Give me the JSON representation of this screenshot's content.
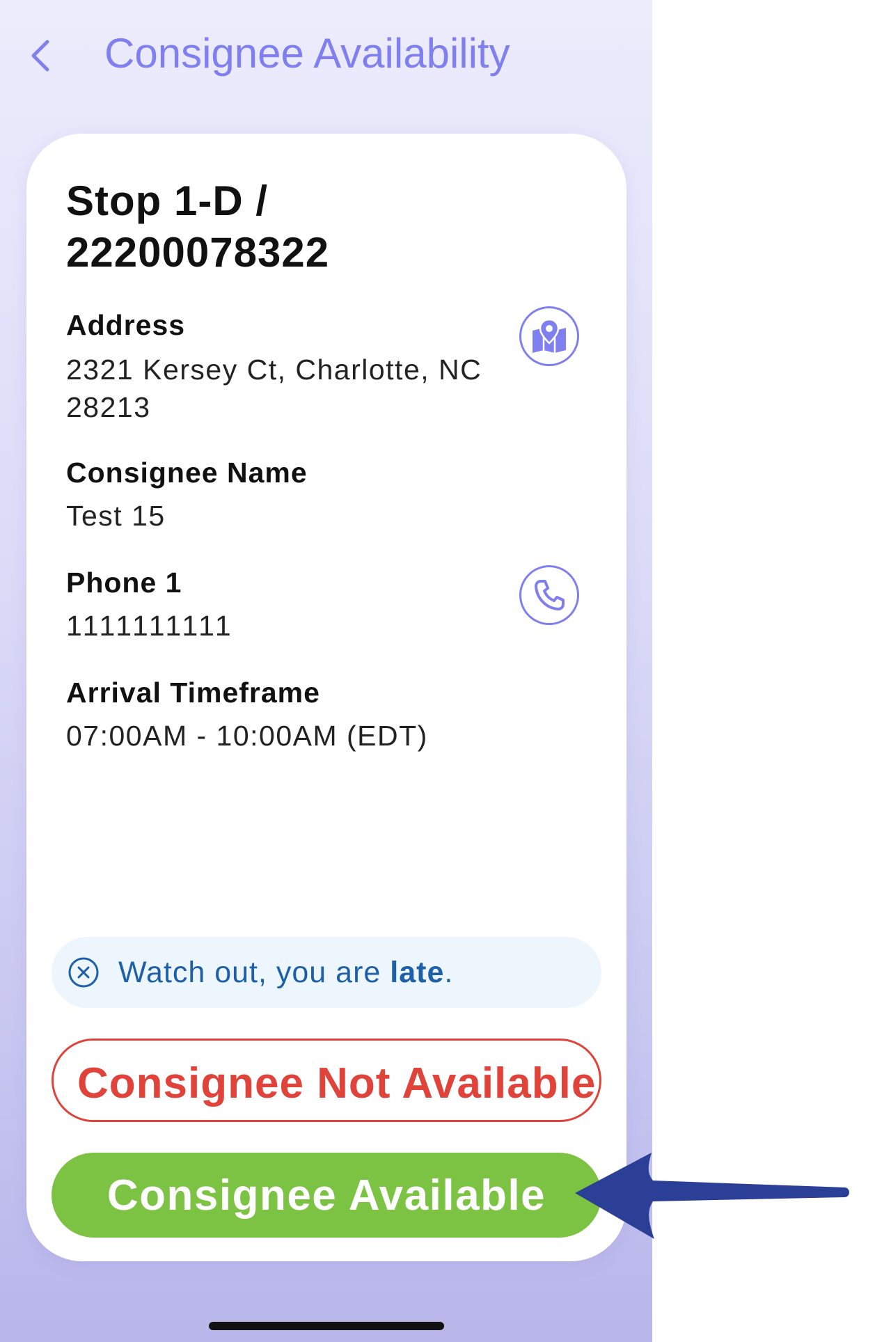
{
  "header": {
    "title": "Consignee Availability",
    "back_icon": "chevron-left-icon"
  },
  "stop": {
    "title": "Stop 1-D / 22200078322"
  },
  "fields": {
    "address_label": "Address",
    "address_value": "2321 Kersey Ct, Charlotte, NC 28213",
    "consignee_label": "Consignee Name",
    "consignee_value": "Test 15",
    "phone_label": "Phone 1",
    "phone_value": "1111111111",
    "timeframe_label": "Arrival Timeframe",
    "timeframe_value": "07:00AM - 10:00AM (EDT)"
  },
  "icons": {
    "map": "map-pin-icon",
    "phone": "phone-icon",
    "late": "close-circle-icon",
    "annotation": "arrow-left-icon"
  },
  "banner": {
    "prefix": "Watch out, you are ",
    "emphasis": "late",
    "suffix": "."
  },
  "actions": {
    "not_available_label": "Consignee Not Available",
    "available_label": "Consignee Available"
  },
  "colors": {
    "accent": "#7f7ff0",
    "danger": "#e0433a",
    "success": "#7cc243",
    "info_text": "#1d5fa8",
    "info_bg": "#edf6fd",
    "annotation_arrow": "#2b3f96"
  }
}
